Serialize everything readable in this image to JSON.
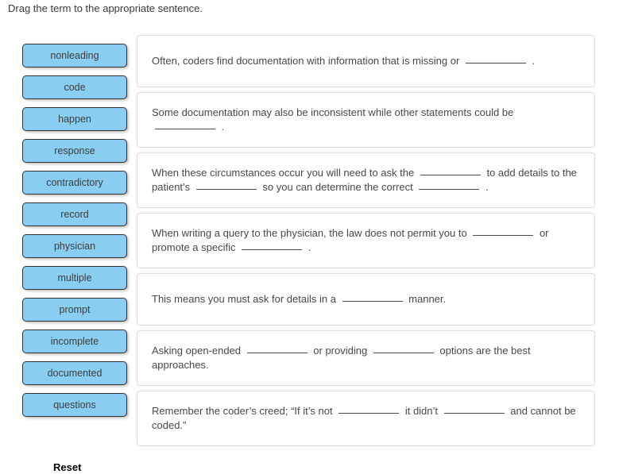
{
  "instruction": "Drag the term to the appropriate sentence.",
  "colors": {
    "tile_fill": "#89cdf1",
    "tile_border": "#333333",
    "box_border": "#dcdcdc",
    "text": "#484848"
  },
  "terms": [
    {
      "label": "nonleading"
    },
    {
      "label": "code"
    },
    {
      "label": "happen"
    },
    {
      "label": "response"
    },
    {
      "label": "contradictory"
    },
    {
      "label": "record"
    },
    {
      "label": "physician"
    },
    {
      "label": "multiple"
    },
    {
      "label": "prompt"
    },
    {
      "label": "incomplete"
    },
    {
      "label": "documented"
    },
    {
      "label": "questions"
    }
  ],
  "sentences": [
    {
      "size": "h1",
      "parts": [
        {
          "type": "text",
          "value": "Often, coders find documentation with information that is missing or "
        },
        {
          "type": "blank"
        },
        {
          "type": "text",
          "value": " ."
        }
      ]
    },
    {
      "size": "h2",
      "parts": [
        {
          "type": "text",
          "value": "Some documentation may also be inconsistent while other statements could be "
        },
        {
          "type": "blank"
        },
        {
          "type": "text",
          "value": " ."
        }
      ]
    },
    {
      "size": "h2",
      "parts": [
        {
          "type": "text",
          "value": "When these circumstances occur you will need to ask the "
        },
        {
          "type": "blank"
        },
        {
          "type": "text",
          "value": " to add details to the patient’s "
        },
        {
          "type": "blank"
        },
        {
          "type": "text",
          "value": " so you can determine the correct "
        },
        {
          "type": "blank"
        },
        {
          "type": "text",
          "value": " ."
        }
      ]
    },
    {
      "size": "h2",
      "parts": [
        {
          "type": "text",
          "value": "When writing a query to the physician, the law does not permit you to "
        },
        {
          "type": "blank"
        },
        {
          "type": "text",
          "value": " or promote a specific "
        },
        {
          "type": "blank"
        },
        {
          "type": "text",
          "value": " ."
        }
      ]
    },
    {
      "size": "h1",
      "parts": [
        {
          "type": "text",
          "value": "This means you must ask for details in a "
        },
        {
          "type": "blank"
        },
        {
          "type": "text",
          "value": " manner."
        }
      ]
    },
    {
      "size": "h2",
      "parts": [
        {
          "type": "text",
          "value": "Asking open-ended "
        },
        {
          "type": "blank"
        },
        {
          "type": "text",
          "value": " or providing "
        },
        {
          "type": "blank"
        },
        {
          "type": "text",
          "value": " options are the best approaches."
        }
      ]
    },
    {
      "size": "h2",
      "parts": [
        {
          "type": "text",
          "value": "Remember the coder’s creed; “If it’s not "
        },
        {
          "type": "blank"
        },
        {
          "type": "text",
          "value": " it didn’t "
        },
        {
          "type": "blank"
        },
        {
          "type": "text",
          "value": " and cannot be coded.”"
        }
      ]
    }
  ],
  "reset_label": "Reset"
}
